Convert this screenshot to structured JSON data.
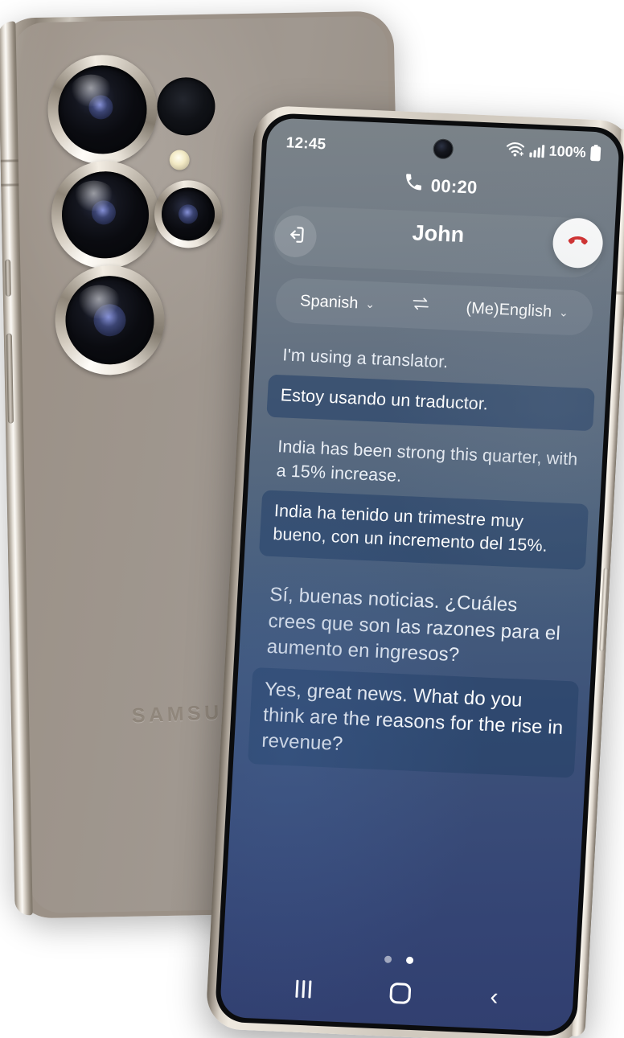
{
  "device": {
    "brand_logo": "SAMSUNG",
    "rear_camera": {
      "lenses": [
        "main-lens",
        "ultrawide-lens",
        "telephoto-lens",
        "periscope-lens"
      ],
      "extras": [
        "depth-sensor",
        "led-flash"
      ]
    }
  },
  "status_bar": {
    "time": "12:45",
    "battery_percent": "100%",
    "icons": [
      "wifi-icon",
      "signal-bars-icon",
      "battery-icon"
    ]
  },
  "call": {
    "timer": "00:20",
    "phone_icon": "phone-handset-icon",
    "contact_name": "John",
    "exit_icon": "exit-arrow-icon",
    "end_call_icon": "end-call-handset-icon"
  },
  "language_bar": {
    "source_language": "Spanish",
    "target_language": "(Me)English",
    "swap_icon": "swap-arrows-icon",
    "chevron_icon": "chevron-down-icon"
  },
  "conversation": [
    {
      "original": "I'm using a translator.",
      "translation": "Estoy usando un traductor.",
      "emphasis": false
    },
    {
      "original": "India has been strong this quarter, with a 15% increase.",
      "translation": "India ha tenido un trimestre muy bueno, con un incremento del 15%.",
      "emphasis": false
    },
    {
      "original": "Sí, buenas noticias. ¿Cuáles crees que son las razones para el aumento en ingresos?",
      "translation": "Yes, great news. What do you think are the reasons for the rise in revenue?",
      "emphasis": true
    }
  ],
  "pagination": {
    "total": 2,
    "active": 2
  },
  "navigation_bar": {
    "recent_label": "recent-apps",
    "home_label": "home",
    "back_label": "back"
  },
  "colors": {
    "screen_top": "#7b8389",
    "screen_bottom": "#313f70",
    "bubble": "#264269",
    "end_call_red": "#d32f2f",
    "frame_titanium": "#cfc8bd",
    "back_body": "#9b9187"
  }
}
